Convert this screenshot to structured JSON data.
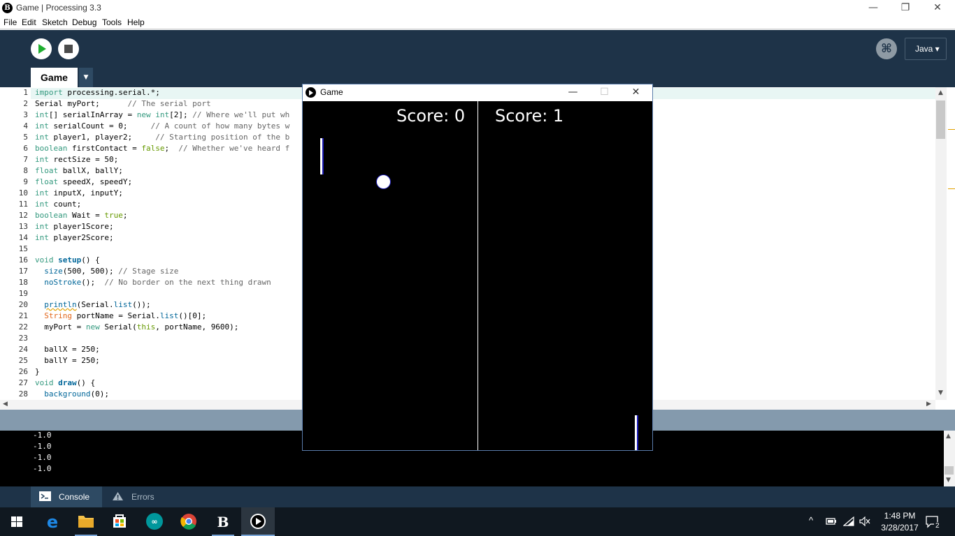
{
  "window": {
    "title": "Game | Processing 3.3",
    "logo_text": "B",
    "minimize": "—",
    "restore": "❐",
    "close": "✕"
  },
  "menu": [
    "File",
    "Edit",
    "Sketch",
    "Debug",
    "Tools",
    "Help"
  ],
  "toolbar": {
    "debug_glyph": "⌘",
    "mode": "Java ▾",
    "tab_name": "Game",
    "tab_dropdown": "▼"
  },
  "editor": {
    "line_numbers": [
      "1",
      "2",
      "3",
      "4",
      "5",
      "6",
      "7",
      "8",
      "9",
      "10",
      "11",
      "12",
      "13",
      "14",
      "15",
      "16",
      "17",
      "18",
      "19",
      "20",
      "21",
      "22",
      "23",
      "24",
      "25",
      "26",
      "27",
      "28"
    ]
  },
  "console": {
    "lines": [
      "-1.0",
      "-1.0",
      "-1.0",
      "-1.0"
    ],
    "tab_console": "Console",
    "tab_errors": "Errors"
  },
  "sketch": {
    "title": "Game",
    "score_left": "Score: 0",
    "score_right": "Score: 1",
    "min": "—",
    "max": "☐",
    "close": "✕"
  },
  "taskbar": {
    "time": "1:48 PM",
    "date": "3/28/2017",
    "notifications": "2"
  }
}
